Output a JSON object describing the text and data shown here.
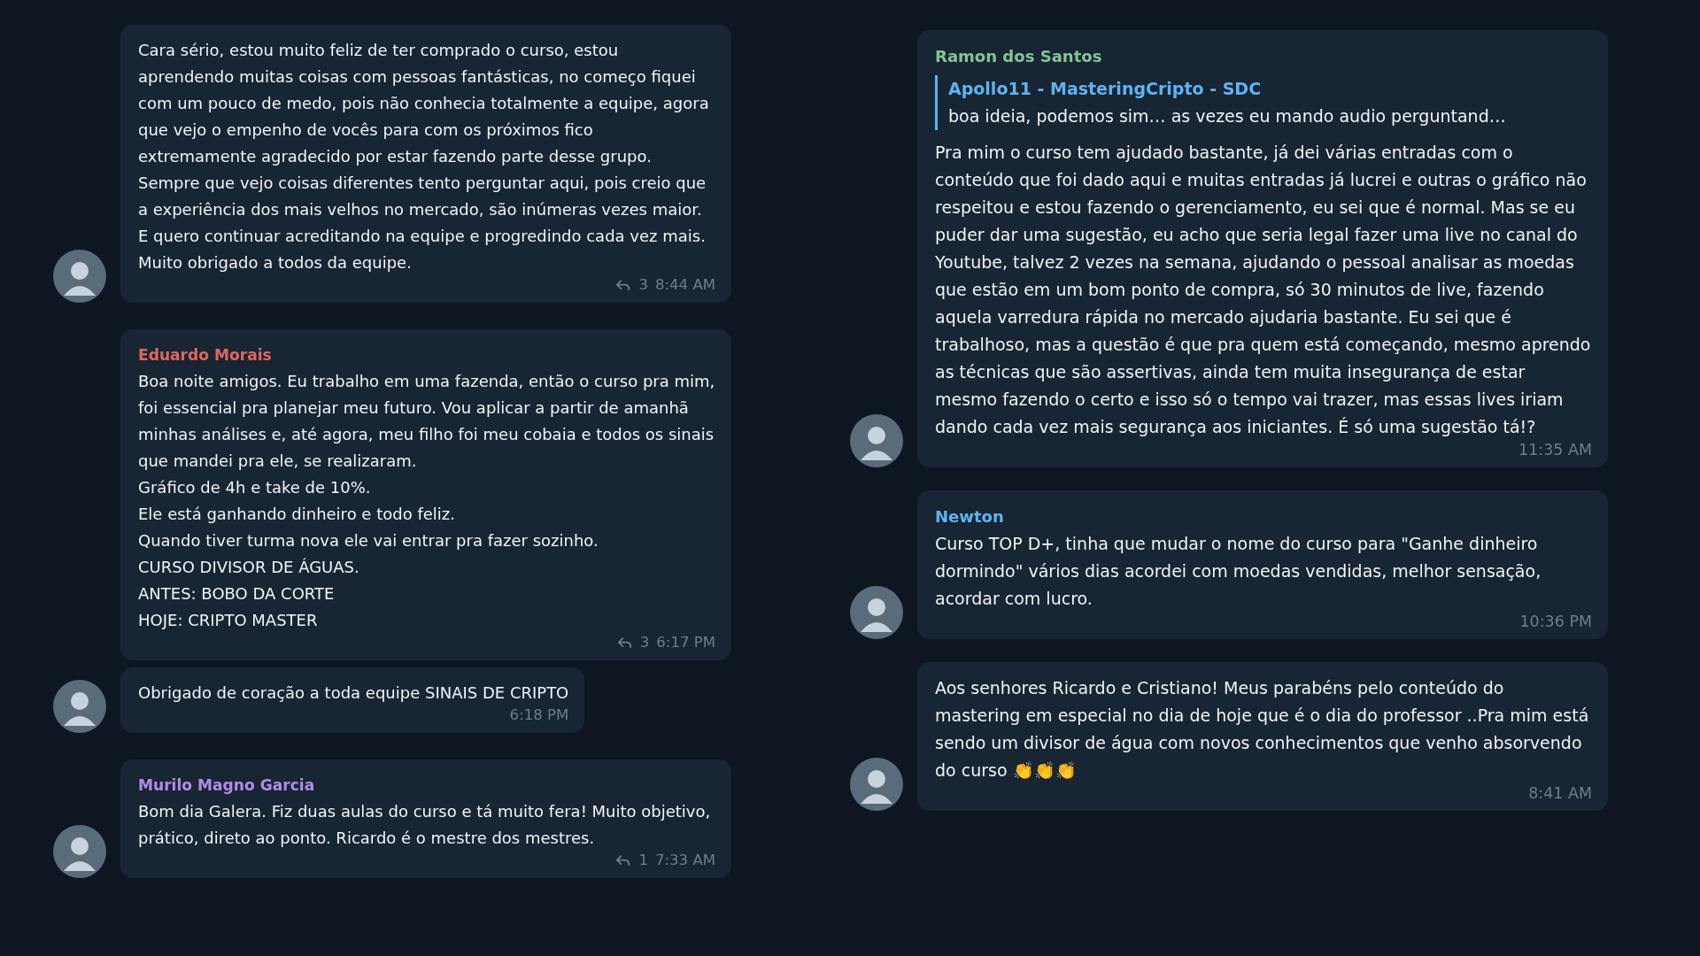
{
  "columns": [
    {
      "messages": [
        {
          "has_avatar": true,
          "text": "Cara sério, estou muito feliz de ter comprado o curso, estou aprendendo muitas coisas com pessoas fantásticas, no começo fiquei com um pouco de medo, pois não conhecia totalmente a equipe, agora que vejo o empenho de vocês para com os próximos fico extremamente agradecido por estar fazendo parte desse grupo. Sempre que vejo coisas diferentes tento perguntar aqui, pois creio que a experiência dos mais velhos no mercado, são inúmeras vezes maior. E quero continuar acreditando na equipe e progredindo cada vez mais. Muito obrigado a todos da equipe.",
          "replies": "3",
          "time": "8:44 AM"
        },
        {
          "has_avatar": false,
          "sender": "Eduardo Morais",
          "color": "#e2665e",
          "text": "Boa noite amigos. Eu trabalho em uma fazenda, então o curso pra mim, foi essencial pra planejar meu futuro. Vou aplicar a partir de amanhã minhas análises e, até agora, meu filho foi meu cobaia e todos os sinais que mandei pra ele, se realizaram.\nGráfico de 4h e take de 10%.\nEle está ganhando dinheiro e todo feliz.\nQuando tiver turma nova ele vai entrar pra fazer sozinho.\nCURSO DIVISOR DE ÁGUAS.\nANTES: BOBO DA CORTE\nHOJE: CRIPTO MASTER",
          "replies": "3",
          "time": "6:17 PM"
        },
        {
          "has_avatar": true,
          "text": "Obrigado de coração a toda equipe SINAIS DE CRIPTO",
          "time": "6:18 PM"
        },
        {
          "has_avatar": true,
          "sender": "Murilo Magno Garcia",
          "color": "#b18be6",
          "text": "Bom dia Galera. Fiz duas aulas do  curso e tá muito fera! Muito objetivo, prático, direto ao ponto. Ricardo é o mestre dos mestres.",
          "replies": "1",
          "time": "7:33 AM"
        }
      ]
    },
    {
      "messages": [
        {
          "has_avatar": true,
          "sender": "Ramon dos Santos",
          "color": "#83c596",
          "reply_to": {
            "author": "Apollo11 - MasteringCripto - SDC",
            "text": "boa ideia, podemos sim… as vezes eu mando audio perguntand…"
          },
          "text": "Pra mim o curso tem ajudado bastante, já dei várias entradas com o conteúdo que foi dado aqui e muitas entradas já lucrei e outras o gráfico não respeitou e estou fazendo o gerenciamento, eu sei que é normal. Mas se eu puder dar uma sugestão, eu acho que seria legal fazer uma live no canal do Youtube, talvez 2 vezes na semana, ajudando o pessoal analisar as moedas que estão em um bom ponto de compra, só 30 minutos de live, fazendo aquela varredura rápida no mercado ajudaria bastante. Eu sei que é trabalhoso, mas a questão é que pra quem está começando, mesmo aprendo as técnicas que são assertivas, ainda tem muita insegurança de estar mesmo fazendo o certo e isso só o tempo vai trazer, mas essas lives iriam dando cada vez mais segurança aos iniciantes. É só uma sugestão tá!?",
          "time": "11:35 AM"
        },
        {
          "has_avatar": true,
          "sender": "Newton",
          "color": "#5db4f2",
          "text": "Curso TOP D+, tinha que mudar o nome do curso para \"Ganhe dinheiro dormindo\"  vários dias acordei com moedas vendidas, melhor sensação, acordar com lucro.",
          "time": "10:36 PM"
        },
        {
          "has_avatar": true,
          "text": "Aos senhores Ricardo e Cristiano! Meus parabéns pelo conteúdo do mastering em especial no dia de hoje que é o dia do professor ..Pra mim está sendo um divisor de água com novos conhecimentos que venho absorvendo do curso 👏👏👏",
          "time": "8:41 AM"
        }
      ]
    }
  ]
}
